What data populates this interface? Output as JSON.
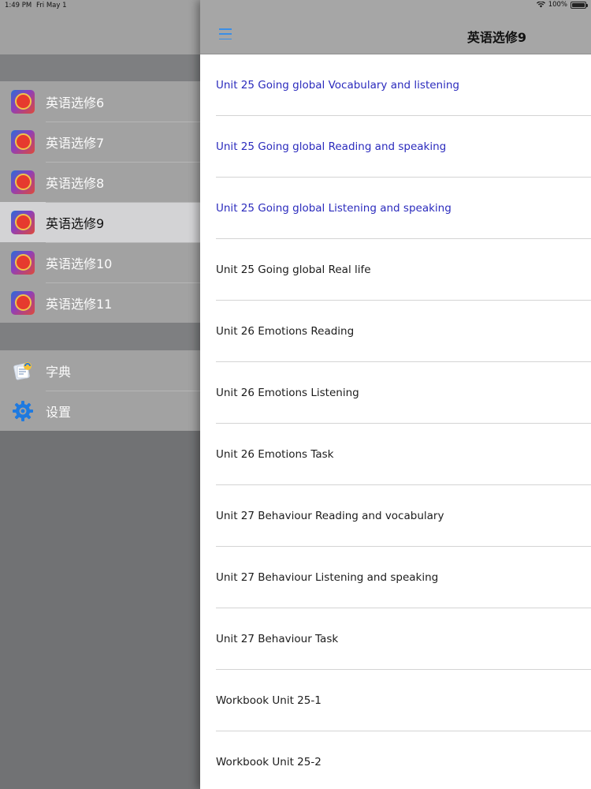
{
  "status_bar": {
    "time": "1:49 PM",
    "date": "Fri May 1",
    "battery": "100%",
    "icons": [
      "wifi-icon",
      "battery-icon"
    ]
  },
  "sidebar": {
    "books": [
      {
        "label": "英语选修6",
        "icon": "book-cover-icon"
      },
      {
        "label": "英语选修7",
        "icon": "book-cover-icon"
      },
      {
        "label": "英语选修8",
        "icon": "book-cover-icon"
      },
      {
        "label": "英语选修9",
        "icon": "book-cover-icon",
        "selected": true
      },
      {
        "label": "英语选修10",
        "icon": "book-cover-icon"
      },
      {
        "label": "英语选修11",
        "icon": "book-cover-icon"
      }
    ],
    "tools": [
      {
        "label": "字典",
        "icon": "dictionary-icon"
      },
      {
        "label": "设置",
        "icon": "gear-icon"
      }
    ]
  },
  "navbar": {
    "title": "英语选修9",
    "menu_icon": "hamburger-menu-icon"
  },
  "lessons": [
    {
      "title": "Unit 25 Going global Vocabulary and listening",
      "visited": true
    },
    {
      "title": "Unit 25 Going global Reading and speaking",
      "visited": true
    },
    {
      "title": "Unit 25 Going global Listening and speaking",
      "visited": true
    },
    {
      "title": "Unit 25 Going global Real life",
      "visited": false
    },
    {
      "title": "Unit 26 Emotions Reading",
      "visited": false
    },
    {
      "title": "Unit 26 Emotions Listening",
      "visited": false
    },
    {
      "title": "Unit 26 Emotions Task",
      "visited": false
    },
    {
      "title": "Unit 27 Behaviour Reading and vocabulary",
      "visited": false
    },
    {
      "title": "Unit 27 Behaviour Listening and speaking",
      "visited": false
    },
    {
      "title": "Unit 27 Behaviour Task",
      "visited": false
    },
    {
      "title": "Workbook Unit 25-1",
      "visited": false
    },
    {
      "title": "Workbook Unit 25-2",
      "visited": false
    }
  ],
  "colors": {
    "accent": "#3a8ee6",
    "visited_link": "#2b2bbd",
    "selected_row": "#d3d3d5"
  }
}
